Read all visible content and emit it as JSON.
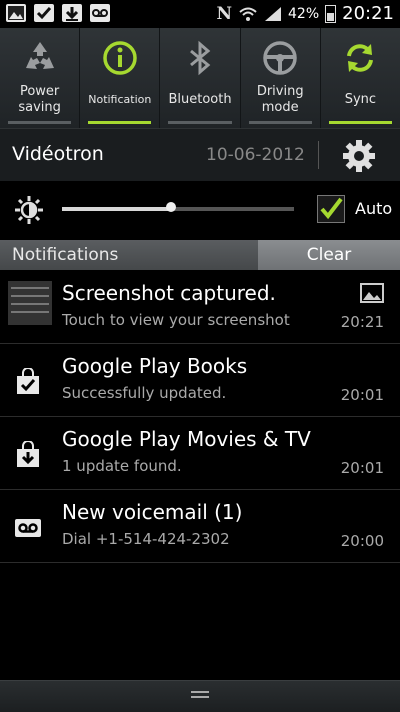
{
  "statusbar": {
    "left_icons": [
      "picture-icon",
      "checkmark-icon",
      "download-icon",
      "voicemail-icon"
    ],
    "battery": "42%",
    "clock": "20:21"
  },
  "toggles": [
    {
      "label": "Power saving",
      "icon": "recycle-icon",
      "active": false
    },
    {
      "label": "Notification",
      "icon": "info-icon",
      "active": true
    },
    {
      "label": "Bluetooth",
      "icon": "bluetooth-icon",
      "active": false
    },
    {
      "label": "Driving mode",
      "icon": "steering-wheel-icon",
      "active": false
    },
    {
      "label": "Sync",
      "icon": "sync-icon",
      "active": true
    }
  ],
  "carrier": {
    "name": "Vidéotron",
    "date": "10-06-2012"
  },
  "brightness": {
    "level": 0.47,
    "auto_label": "Auto",
    "auto_checked": true
  },
  "notifications_header": {
    "title": "Notifications",
    "clear_label": "Clear"
  },
  "notifications": [
    {
      "title": "Screenshot captured.",
      "subtitle": "Touch to view your screenshot",
      "time": "20:21",
      "icon": "screenshot-thumbnail"
    },
    {
      "title": "Google Play Books",
      "subtitle": "Successfully updated.",
      "time": "20:01",
      "icon": "shopping-bag-check-icon"
    },
    {
      "title": "Google Play Movies & TV",
      "subtitle": "1 update found.",
      "time": "20:01",
      "icon": "shopping-bag-download-icon"
    },
    {
      "title": "New voicemail (1)",
      "subtitle": "Dial +1-514-424-2302",
      "time": "20:00",
      "icon": "voicemail-icon"
    }
  ],
  "colors": {
    "accent": "#a6d930",
    "background": "#000000"
  }
}
